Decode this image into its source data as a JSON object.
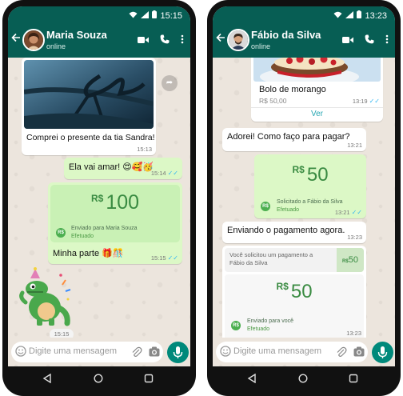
{
  "left": {
    "status_time": "15:15",
    "contact_name": "Maria Souza",
    "contact_status": "online",
    "gift_caption": "Comprei o presente da tia Sandra!",
    "gift_time": "15:13",
    "msg1_text": "Ela vai amar! 😍🥰🥳",
    "msg1_time": "15:14",
    "payment_currency": "R$",
    "payment_value": "100",
    "payment_line1": "Enviado para Maria Souza",
    "payment_line2": "Efetuado",
    "payment_badge": "R$",
    "payment_caption": "Minha parte 🎁🎊",
    "payment_time": "15:15",
    "sticker_time": "15:15",
    "input_placeholder": "Digite uma mensagem"
  },
  "right": {
    "status_time": "13:23",
    "contact_name": "Fábio da Silva",
    "contact_status": "online",
    "product_name": "Bolo de morango",
    "product_price": "R$ 50,00",
    "product_time": "13:19",
    "product_link": "Ver",
    "msg1_text": "Adorei! Como faço para pagar?",
    "msg1_time": "13:21",
    "pay1_currency": "R$",
    "pay1_value": "50",
    "pay1_line1": "Solicitado a Fábio da Silva",
    "pay1_line2": "Efetuado",
    "pay1_badge": "R$",
    "pay1_time": "13:21",
    "msg2_text": "Enviando o pagamento agora.",
    "msg2_time": "13:23",
    "req_text": "Você solicitou um pagamento a Fábio da Silva",
    "req_thumb_currency": "R$",
    "req_thumb_value": "50",
    "pay2_currency": "R$",
    "pay2_value": "50",
    "pay2_line1": "Enviado para você",
    "pay2_line2": "Efetuado",
    "pay2_badge": "R$",
    "pay2_time": "13:23",
    "input_placeholder": "Digite uma mensagem"
  },
  "colors": {
    "header": "#075e54",
    "outgoing": "#dcf8c6",
    "accent": "#00897b",
    "check": "#34b7f1"
  },
  "icons": [
    "back-arrow-icon",
    "video-call-icon",
    "phone-icon",
    "menu-dots-icon",
    "forward-icon",
    "emoji-icon",
    "attach-icon",
    "camera-icon",
    "mic-icon",
    "nav-back-icon",
    "nav-home-icon",
    "nav-recents-icon"
  ]
}
